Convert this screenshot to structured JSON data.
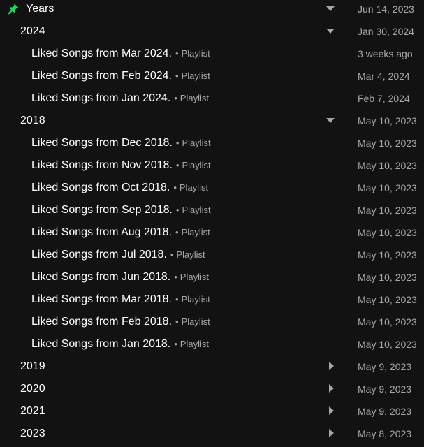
{
  "colors": {
    "background": "#121212",
    "pin": "#1ed760",
    "text_primary": "#ffffff",
    "text_secondary": "#a7a7a7"
  },
  "root": {
    "title": "Years",
    "icon": "pin-icon",
    "date": "Jun 14, 2023",
    "expanded": true
  },
  "separator": "•",
  "folders": [
    {
      "title": "2024",
      "date": "Jan 30, 2024",
      "expanded": true,
      "items": [
        {
          "title": "Liked Songs from Mar 2024.",
          "type": "Playlist",
          "date": "3 weeks ago"
        },
        {
          "title": "Liked Songs from Feb 2024.",
          "type": "Playlist",
          "date": "Mar 4, 2024"
        },
        {
          "title": "Liked Songs from Jan 2024.",
          "type": "Playlist",
          "date": "Feb 7, 2024"
        }
      ]
    },
    {
      "title": "2018",
      "date": "May 10, 2023",
      "expanded": true,
      "items": [
        {
          "title": "Liked Songs from Dec 2018.",
          "type": "Playlist",
          "date": "May 10, 2023"
        },
        {
          "title": "Liked Songs from Nov 2018.",
          "type": "Playlist",
          "date": "May 10, 2023"
        },
        {
          "title": "Liked Songs from Oct 2018.",
          "type": "Playlist",
          "date": "May 10, 2023"
        },
        {
          "title": "Liked Songs from Sep 2018.",
          "type": "Playlist",
          "date": "May 10, 2023"
        },
        {
          "title": "Liked Songs from Aug 2018.",
          "type": "Playlist",
          "date": "May 10, 2023"
        },
        {
          "title": "Liked Songs from Jul 2018.",
          "type": "Playlist",
          "date": "May 10, 2023"
        },
        {
          "title": "Liked Songs from Jun 2018.",
          "type": "Playlist",
          "date": "May 10, 2023"
        },
        {
          "title": "Liked Songs from Mar 2018.",
          "type": "Playlist",
          "date": "May 10, 2023"
        },
        {
          "title": "Liked Songs from Feb 2018.",
          "type": "Playlist",
          "date": "May 10, 2023"
        },
        {
          "title": "Liked Songs from Jan 2018.",
          "type": "Playlist",
          "date": "May 10, 2023"
        }
      ]
    },
    {
      "title": "2019",
      "date": "May 9, 2023",
      "expanded": false,
      "items": []
    },
    {
      "title": "2020",
      "date": "May 9, 2023",
      "expanded": false,
      "items": []
    },
    {
      "title": "2021",
      "date": "May 9, 2023",
      "expanded": false,
      "items": []
    },
    {
      "title": "2023",
      "date": "May 8, 2023",
      "expanded": false,
      "items": []
    }
  ]
}
